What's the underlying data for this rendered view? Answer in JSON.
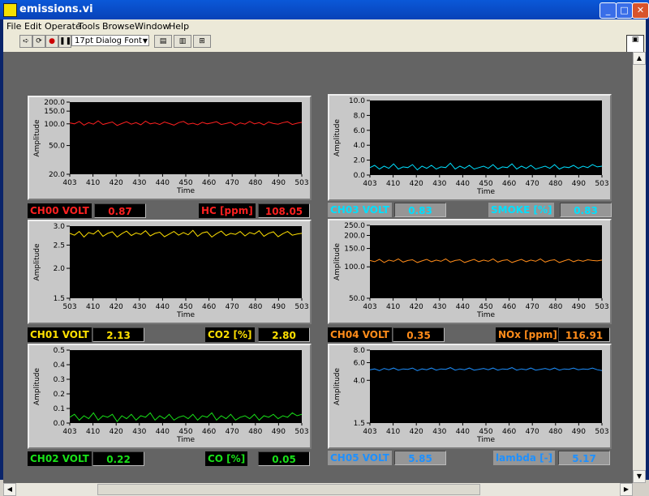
{
  "window": {
    "title": "emissions.vi"
  },
  "menu": [
    "File",
    "Edit",
    "Operate",
    "Tools",
    "Browse",
    "Window",
    "Help"
  ],
  "toolbar": {
    "font_label": "17pt Dialog Font"
  },
  "graphs": [
    {
      "id": "g0",
      "x_label": "Time",
      "y_label": "Amplitude",
      "color": "#ff2020",
      "yticks": [
        "200.0",
        "150.0",
        "100.0",
        "50.0",
        "20.0"
      ],
      "xticks": [
        "403",
        "410",
        "420",
        "430",
        "440",
        "450",
        "460",
        "470",
        "480",
        "490",
        "503"
      ]
    },
    {
      "id": "g1",
      "x_label": "Time",
      "y_label": "Amplitude",
      "color": "#ffe000",
      "yticks": [
        "3.0",
        "2.5",
        "2.0",
        "1.5"
      ],
      "xticks": [
        "503",
        "410",
        "420",
        "430",
        "440",
        "450",
        "460",
        "470",
        "480",
        "490",
        "503"
      ]
    },
    {
      "id": "g2",
      "x_label": "Time",
      "y_label": "Amplitude",
      "color": "#18e018",
      "yticks": [
        "0.5",
        "0.4",
        "0.3",
        "0.2",
        "0.1",
        "0.0"
      ],
      "xticks": [
        "403",
        "410",
        "420",
        "430",
        "440",
        "450",
        "460",
        "470",
        "480",
        "490",
        "503"
      ]
    },
    {
      "id": "g3",
      "x_label": "Time",
      "y_label": "Amplitude",
      "color": "#00e0ff",
      "yticks": [
        "10.0",
        "8.0",
        "6.0",
        "4.0",
        "2.0",
        "0.0"
      ],
      "xticks": [
        "403",
        "410",
        "420",
        "430",
        "440",
        "450",
        "460",
        "470",
        "480",
        "490",
        "503"
      ]
    },
    {
      "id": "g4",
      "x_label": "Time",
      "y_label": "Amplitude",
      "color": "#ff8c1a",
      "yticks": [
        "250.0",
        "200.0",
        "150.0",
        "100.0",
        "50.0"
      ],
      "xticks": [
        "403",
        "410",
        "420",
        "430",
        "440",
        "450",
        "460",
        "470",
        "480",
        "490",
        "503"
      ]
    },
    {
      "id": "g5",
      "x_label": "Time",
      "y_label": "Amplitude",
      "color": "#1e90ff",
      "yticks": [
        "8.0",
        "6.0",
        "4.0",
        "1.5"
      ],
      "xticks": [
        "403",
        "410",
        "420",
        "430",
        "440",
        "450",
        "460",
        "470",
        "480",
        "490",
        "503"
      ]
    }
  ],
  "chart_data": [
    {
      "type": "line",
      "title": "",
      "xlabel": "Time",
      "ylabel": "Amplitude",
      "xlim": [
        403,
        503
      ],
      "ylim": [
        20,
        200
      ],
      "log_y": true,
      "series": [
        {
          "values": [
            103,
            100,
            108,
            96,
            104,
            99,
            110,
            98,
            102,
            106,
            95,
            101,
            107,
            99,
            104,
            97,
            109,
            100,
            103,
            98,
            106,
            101,
            96,
            104,
            108,
            99,
            102,
            97,
            105,
            100,
            103,
            107,
            98,
            101,
            105,
            96,
            103,
            99,
            108,
            100,
            104,
            97,
            106,
            101,
            99,
            104,
            107,
            98,
            102,
            105
          ]
        }
      ]
    },
    {
      "type": "line",
      "title": "",
      "xlabel": "Time",
      "ylabel": "Amplitude",
      "xlim": [
        403,
        503
      ],
      "ylim": [
        1.5,
        3.0
      ],
      "log_y": true,
      "series": [
        {
          "values": [
            2.8,
            2.75,
            2.85,
            2.7,
            2.82,
            2.78,
            2.88,
            2.72,
            2.8,
            2.84,
            2.7,
            2.79,
            2.86,
            2.74,
            2.81,
            2.77,
            2.87,
            2.73,
            2.8,
            2.83,
            2.71,
            2.78,
            2.85,
            2.75,
            2.82,
            2.76,
            2.88,
            2.72,
            2.81,
            2.84,
            2.7,
            2.79,
            2.86,
            2.74,
            2.8,
            2.77,
            2.85,
            2.73,
            2.82,
            2.78,
            2.87,
            2.72,
            2.8,
            2.84,
            2.71,
            2.79,
            2.85,
            2.75,
            2.78,
            2.8
          ]
        }
      ]
    },
    {
      "type": "line",
      "title": "",
      "xlabel": "Time",
      "ylabel": "Amplitude",
      "xlim": [
        403,
        503
      ],
      "ylim": [
        0,
        0.5
      ],
      "series": [
        {
          "values": [
            0.04,
            0.06,
            0.02,
            0.05,
            0.03,
            0.07,
            0.02,
            0.05,
            0.04,
            0.06,
            0.01,
            0.05,
            0.03,
            0.06,
            0.02,
            0.05,
            0.04,
            0.07,
            0.02,
            0.05,
            0.03,
            0.06,
            0.02,
            0.04,
            0.05,
            0.03,
            0.06,
            0.02,
            0.05,
            0.04,
            0.07,
            0.02,
            0.05,
            0.03,
            0.06,
            0.02,
            0.04,
            0.05,
            0.03,
            0.06,
            0.02,
            0.05,
            0.04,
            0.06,
            0.03,
            0.05,
            0.04,
            0.07,
            0.05,
            0.06
          ]
        }
      ]
    },
    {
      "type": "line",
      "title": "",
      "xlabel": "Time",
      "ylabel": "Amplitude",
      "xlim": [
        403,
        503
      ],
      "ylim": [
        0,
        10
      ],
      "series": [
        {
          "values": [
            1.0,
            1.3,
            0.8,
            1.2,
            0.9,
            1.5,
            0.8,
            1.1,
            1.0,
            1.4,
            0.7,
            1.2,
            0.9,
            1.3,
            0.8,
            1.1,
            1.0,
            1.6,
            0.8,
            1.2,
            0.9,
            1.3,
            0.8,
            1.0,
            1.2,
            0.9,
            1.4,
            0.8,
            1.1,
            1.0,
            1.5,
            0.8,
            1.2,
            0.9,
            1.3,
            0.8,
            1.0,
            1.2,
            0.9,
            1.4,
            0.8,
            1.1,
            1.0,
            1.3,
            0.9,
            1.2,
            1.0,
            1.4,
            1.1,
            1.2
          ]
        }
      ]
    },
    {
      "type": "line",
      "title": "",
      "xlabel": "Time",
      "ylabel": "Amplitude",
      "xlim": [
        403,
        503
      ],
      "ylim": [
        50,
        250
      ],
      "log_y": true,
      "series": [
        {
          "values": [
            115,
            112,
            118,
            110,
            116,
            113,
            119,
            111,
            115,
            117,
            110,
            114,
            118,
            112,
            116,
            113,
            119,
            111,
            115,
            117,
            110,
            114,
            118,
            112,
            116,
            113,
            119,
            111,
            115,
            117,
            110,
            114,
            118,
            112,
            116,
            113,
            119,
            111,
            115,
            117,
            110,
            114,
            118,
            112,
            116,
            113,
            117,
            115,
            114,
            116
          ]
        }
      ]
    },
    {
      "type": "line",
      "title": "",
      "xlabel": "Time",
      "ylabel": "Amplitude",
      "xlim": [
        403,
        503
      ],
      "ylim": [
        1.5,
        8.0
      ],
      "log_y": true,
      "series": [
        {
          "values": [
            5.1,
            5.2,
            5.0,
            5.25,
            5.1,
            5.3,
            5.05,
            5.2,
            5.15,
            5.3,
            5.0,
            5.2,
            5.1,
            5.3,
            5.05,
            5.2,
            5.15,
            5.35,
            5.05,
            5.2,
            5.1,
            5.3,
            5.05,
            5.15,
            5.25,
            5.1,
            5.3,
            5.05,
            5.2,
            5.15,
            5.35,
            5.05,
            5.2,
            5.1,
            5.3,
            5.05,
            5.15,
            5.25,
            5.1,
            5.3,
            5.05,
            5.2,
            5.15,
            5.3,
            5.1,
            5.2,
            5.15,
            5.3,
            5.1,
            5.0
          ]
        }
      ]
    }
  ],
  "indicators": {
    "ch00_label": "CH00 VOLT",
    "ch00_value": "0.87",
    "hc_label": "HC [ppm]",
    "hc_value": "108.05",
    "ch01_label": "CH01 VOLT",
    "ch01_value": "2.13",
    "co2_label": "CO2 [%]",
    "co2_value": "2.80",
    "ch02_label": "CH02 VOLT",
    "ch02_value": "0.22",
    "co_label": "CO [%]",
    "co_value": "0.05",
    "ch03_label": "CH03 VOLT",
    "ch03_value": "0.83",
    "smoke_label": "SMOKE [%]",
    "smoke_value": "0.83",
    "ch04_label": "CH04 VOLT",
    "ch04_value": "0.35",
    "nox_label": "NOx [ppm]",
    "nox_value": "116.91",
    "ch05_label": "CH05 VOLT",
    "ch05_value": "5.85",
    "lambda_label": "lambda [-]",
    "lambda_value": "5.17"
  },
  "colors": {
    "hc": "#ff2020",
    "co2": "#ffe000",
    "co": "#18e018",
    "smoke": "#00e0ff",
    "nox": "#ff8c1a",
    "lambda": "#1e90ff",
    "panel": "#646464"
  }
}
